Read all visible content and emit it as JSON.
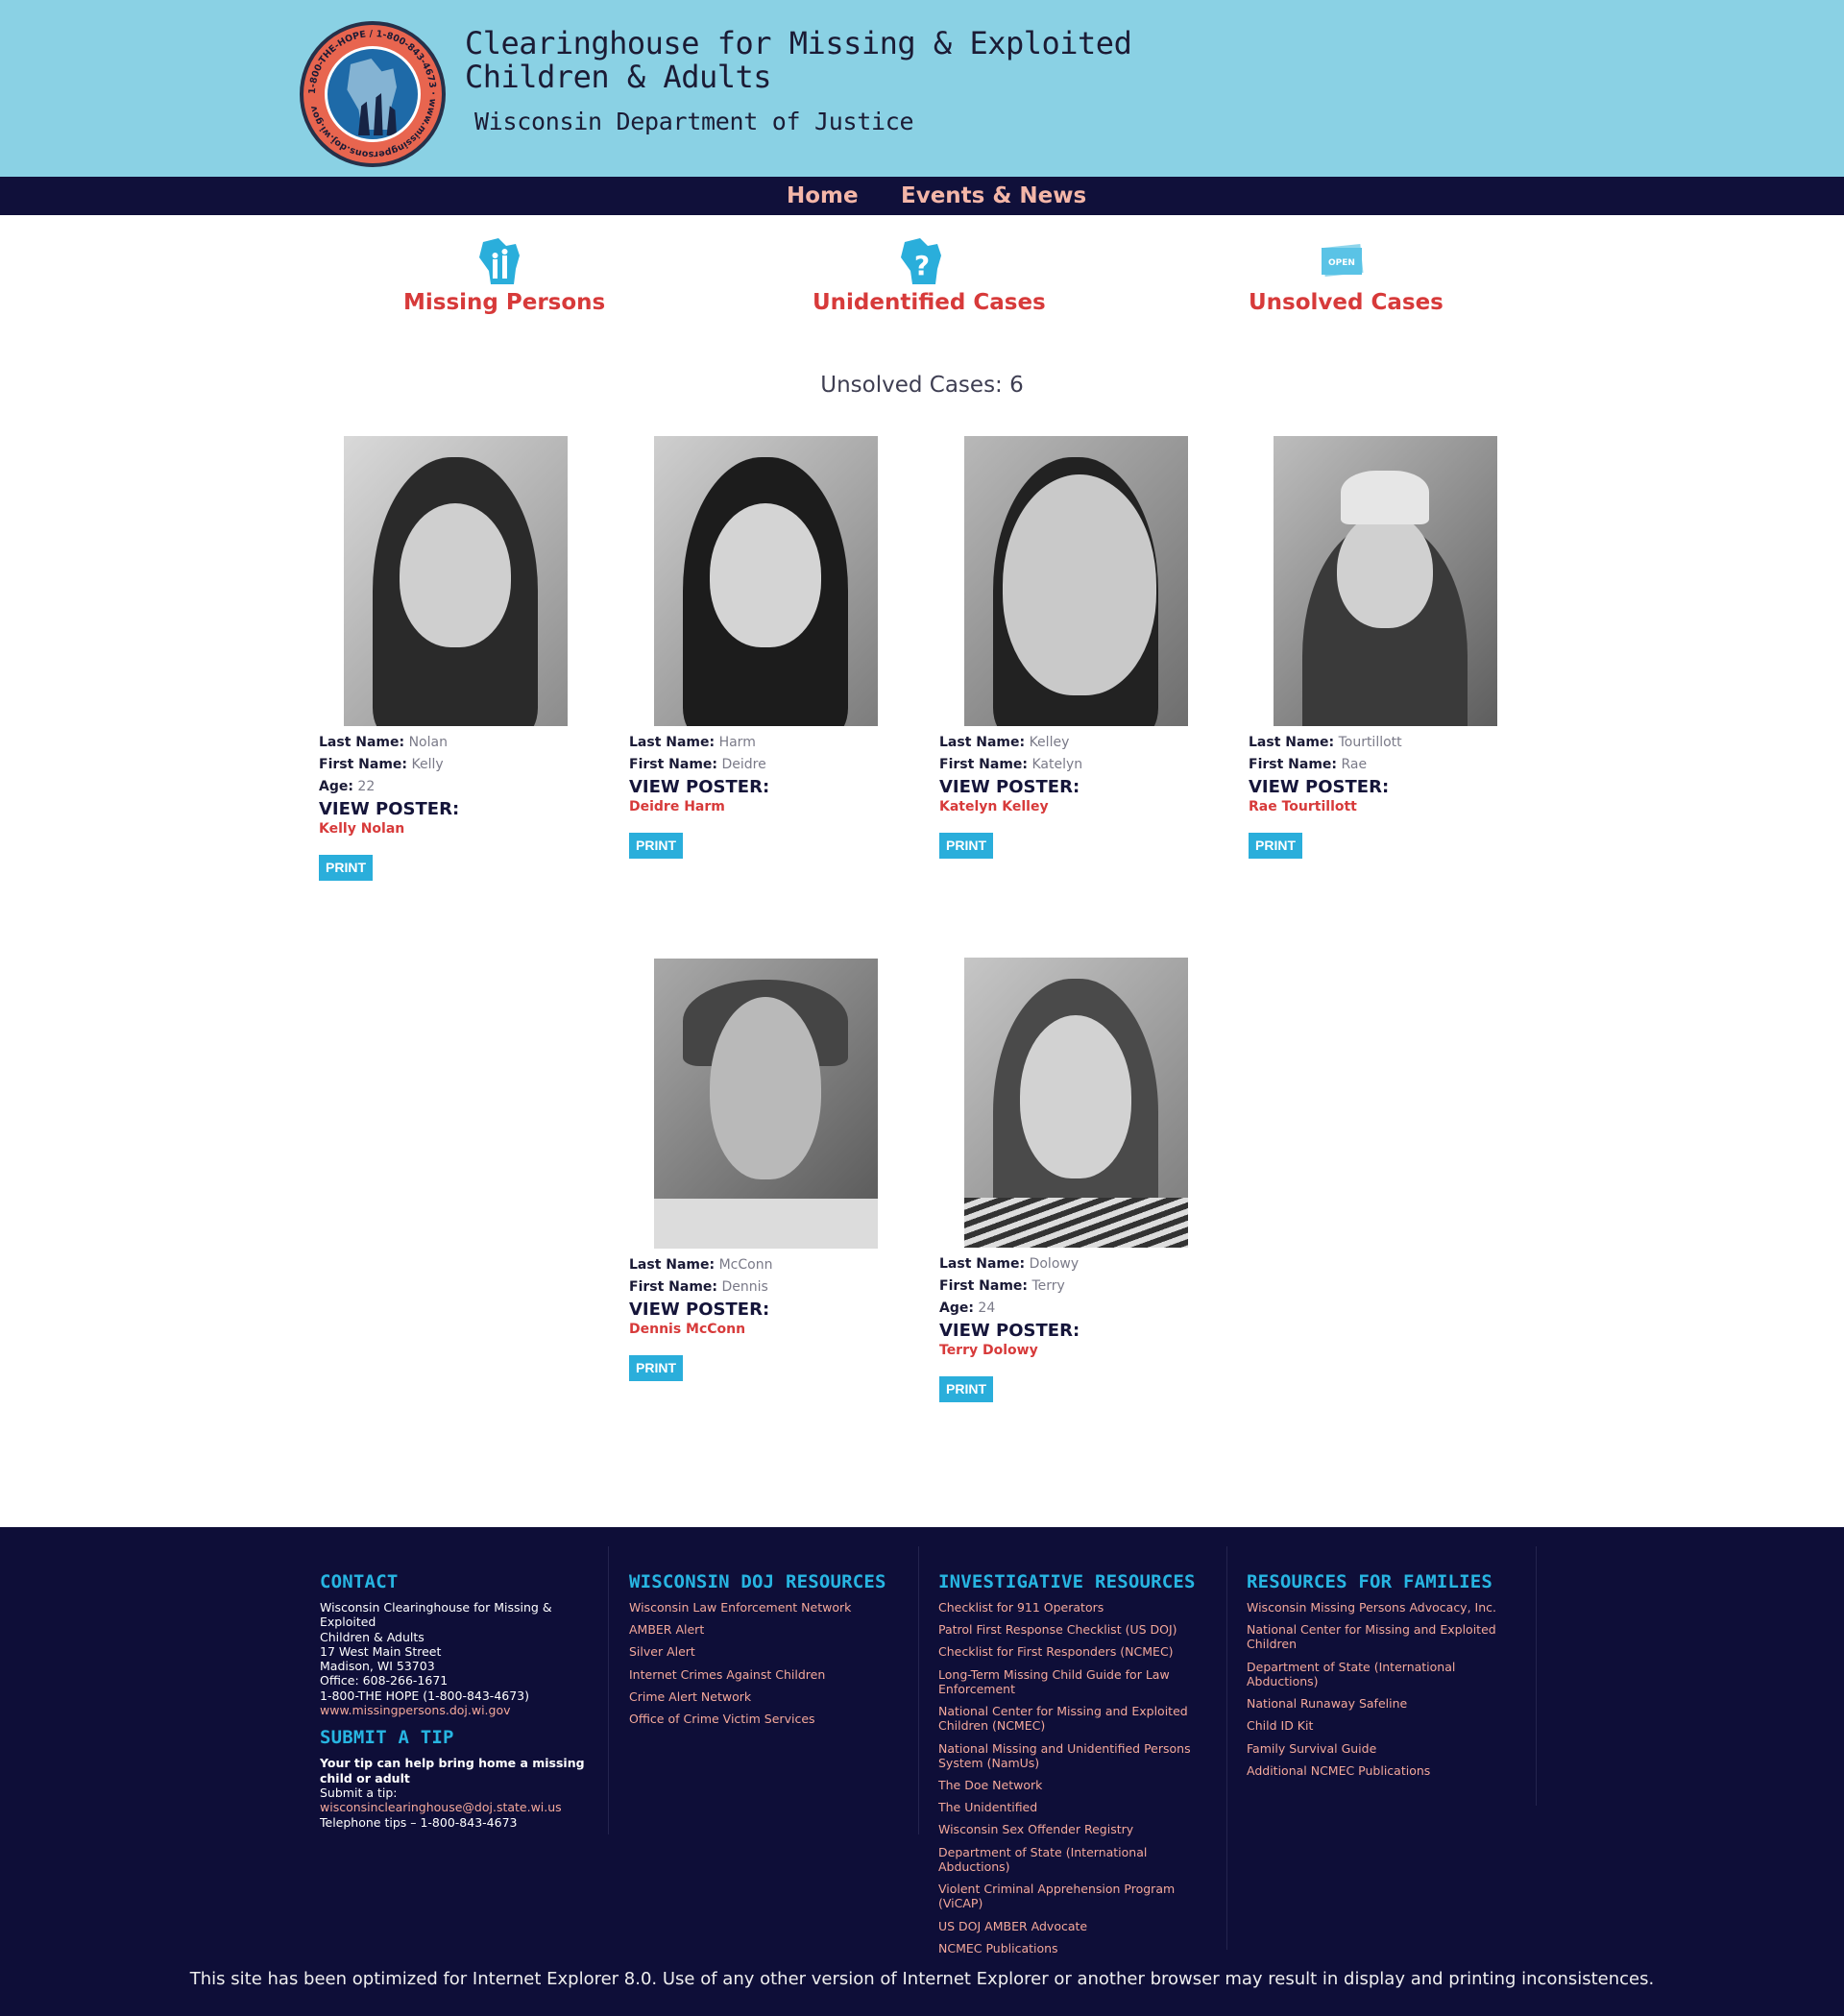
{
  "header": {
    "logo_ring_text": "1-800-THE-HOPE / 1-800-843-4673 · www.missingpersons.doj.wi.gov",
    "title": "Clearinghouse for Missing & Exploited Children & Adults",
    "subtitle": "Wisconsin Department of Justice"
  },
  "nav": {
    "home": "Home",
    "events": "Events & News"
  },
  "categories": {
    "missing": "Missing Persons",
    "unidentified": "Unidentified Cases",
    "unsolved": "Unsolved Cases",
    "open_badge": "OPEN"
  },
  "count_label": "Unsolved Cases: 6",
  "labels": {
    "last": "Last Name:",
    "first": "First Name:",
    "age": "Age:",
    "view_poster": "VIEW POSTER:",
    "print": "PRINT"
  },
  "cases": [
    {
      "last": "Nolan",
      "first": "Kelly",
      "age": "22",
      "poster": "Kelly Nolan"
    },
    {
      "last": "Harm",
      "first": "Deidre",
      "poster": "Deidre Harm"
    },
    {
      "last": "Kelley",
      "first": "Katelyn",
      "poster": "Katelyn Kelley"
    },
    {
      "last": "Tourtillott",
      "first": "Rae",
      "poster": "Rae Tourtillott"
    },
    {
      "last": "McConn",
      "first": "Dennis",
      "poster": "Dennis McConn"
    },
    {
      "last": "Dolowy",
      "first": "Terry",
      "age": "24",
      "poster": "Terry Dolowy"
    }
  ],
  "footer": {
    "contact": {
      "heading": "CONTACT",
      "lines": [
        "Wisconsin Clearinghouse for Missing & Exploited",
        "Children & Adults",
        "17 West Main Street",
        "Madison, WI  53703",
        "Office:  608-266-1671",
        "1-800-THE HOPE (1-800-843-4673)"
      ],
      "website": "www.missingpersons.doj.wi.gov"
    },
    "tip": {
      "heading": "SUBMIT A TIP",
      "strong": "Your tip can help bring home a missing child or adult",
      "submit": "Submit a tip:",
      "email": "wisconsinclearinghouse@doj.state.wi.us",
      "phone": "Telephone tips – 1-800-843-4673"
    },
    "doj": {
      "heading": "WISCONSIN DOJ RESOURCES",
      "links": [
        "Wisconsin Law Enforcement Network",
        "AMBER Alert",
        "Silver Alert",
        "Internet Crimes Against Children",
        "Crime Alert Network",
        "Office of Crime Victim Services"
      ]
    },
    "investigative": {
      "heading": "INVESTIGATIVE RESOURCES",
      "links": [
        "Checklist for 911 Operators",
        "Patrol First Response Checklist (US DOJ)",
        "Checklist for First Responders (NCMEC)",
        "Long-Term Missing Child Guide for Law Enforcement",
        "National Center for Missing and Exploited Children (NCMEC)",
        "National Missing and Unidentified Persons System (NamUs)",
        "The Doe Network",
        "The Unidentified",
        "Wisconsin Sex Offender Registry",
        "Department of State (International Abductions)",
        "Violent Criminal Apprehension Program (ViCAP)",
        "US DOJ AMBER Advocate",
        "NCMEC Publications"
      ]
    },
    "families": {
      "heading": "RESOURCES FOR FAMILIES",
      "links": [
        "Wisconsin Missing Persons Advocacy, Inc.",
        "National Center for Missing and Exploited Children",
        "Department of State (International Abductions)",
        "National Runaway Safeline",
        "Child ID Kit",
        "Family Survival Guide",
        "Additional NCMEC Publications"
      ]
    },
    "disclaimer": "This site has been optimized for Internet Explorer 8.0. Use of any other version of Internet Explorer or another browser may result in display and printing inconsistences."
  },
  "colors": {
    "header_bg": "#8ad1e4",
    "nav_bg": "#10103a",
    "accent_red": "#d73a3a",
    "print_button": "#2aaedb",
    "footer_bg": "#0e0e38",
    "footer_heading": "#27b5e2",
    "footer_link": "#f4a89a"
  }
}
